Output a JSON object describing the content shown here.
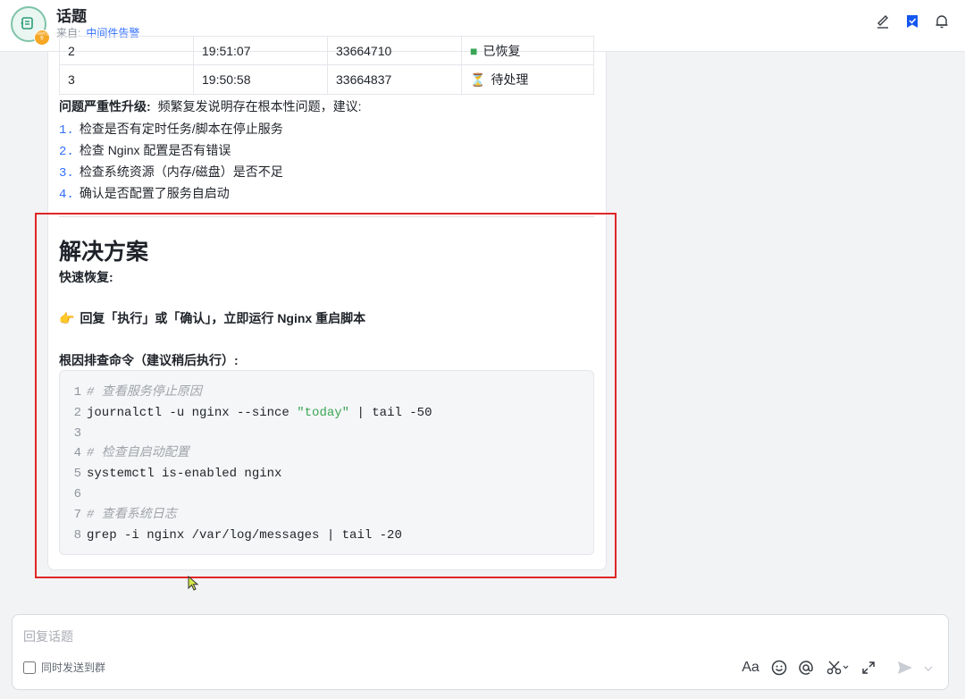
{
  "header": {
    "title": "话题",
    "from_label": "来自:",
    "from_source": "中间件告警",
    "avatar_badge": "中间件告警"
  },
  "table": {
    "rows": [
      {
        "index": "2",
        "time": "19:51:07",
        "pid": "33664710",
        "status": "已恢复"
      },
      {
        "index": "3",
        "time": "19:50:58",
        "pid": "33664837",
        "status": "待处理"
      }
    ]
  },
  "analysis": {
    "upgrade_label": "问题严重性升级:",
    "upgrade_text": "频繁复发说明存在根本性问题，建议:",
    "steps": [
      {
        "num": "1.",
        "text": "检查是否有定时任务/脚本在停止服务"
      },
      {
        "num": "2.",
        "text": "检查 Nginx 配置是否有错误"
      },
      {
        "num": "3.",
        "text": "检查系统资源（内存/磁盘）是否不足"
      },
      {
        "num": "4.",
        "text": "确认是否配置了服务自启动"
      }
    ]
  },
  "solution": {
    "title": "解决方案",
    "quick_label": "快速恢复:",
    "reply_text": "回复「执行」或「确认」，立即运行 Nginx 重启脚本",
    "rootcause_label": "根因排查命令（建议稍后执行）:",
    "code_lines": [
      {
        "n": "1",
        "comment": "# 查看服务停止原因"
      },
      {
        "n": "2",
        "before": "journalctl -u nginx --since ",
        "str": "\"today\"",
        "after": " | tail -50"
      },
      {
        "n": "3",
        "before": ""
      },
      {
        "n": "4",
        "comment": "# 检查自启动配置"
      },
      {
        "n": "5",
        "before": "systemctl is-enabled nginx"
      },
      {
        "n": "6",
        "before": ""
      },
      {
        "n": "7",
        "comment": "# 查看系统日志"
      },
      {
        "n": "8",
        "before": "grep -i nginx /var/log/messages | tail -20"
      }
    ]
  },
  "composer": {
    "placeholder": "回复话题",
    "sync_label": "同时发送到群",
    "font_tool": "Aa"
  },
  "colors": {
    "accent": "#3370ff",
    "highlight_border": "#e02626",
    "code_string": "#3aa655"
  },
  "icons": [
    "notebook-icon",
    "share-icon",
    "bookmark-icon",
    "bell-icon",
    "hourglass-icon",
    "pointing-hand-icon",
    "emoji-icon",
    "mention-icon",
    "scissors-icon",
    "expand-icon",
    "send-icon",
    "chevron-down-icon"
  ]
}
